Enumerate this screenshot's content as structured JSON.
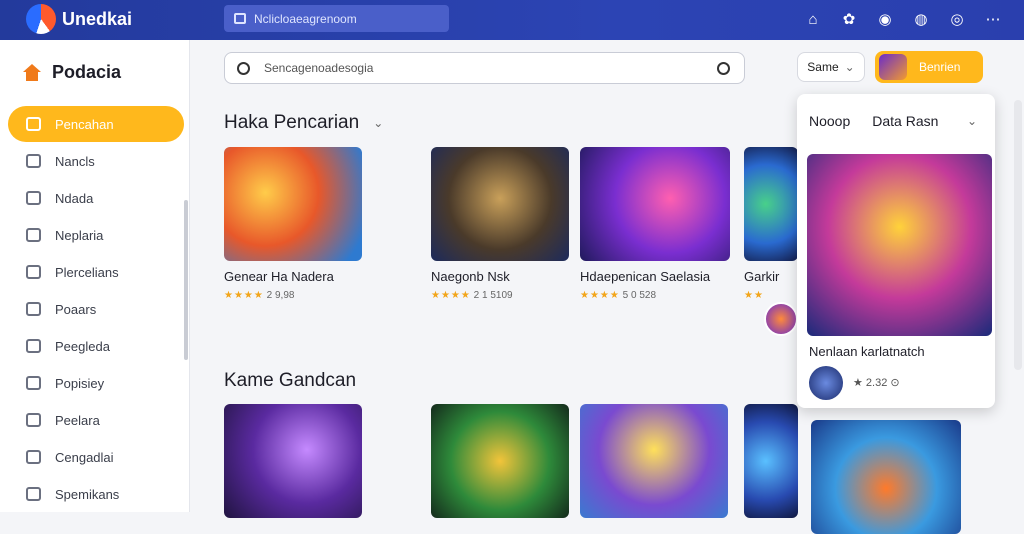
{
  "topbar": {
    "brand": "Unedkai",
    "url": "Nclicloaeagrenoom",
    "icons": [
      "home-icon",
      "extension-icon",
      "record-icon",
      "camera-icon",
      "profile-icon",
      "more-icon"
    ]
  },
  "sidebar": {
    "title": "Podacia",
    "items": [
      {
        "label": "Pencahan",
        "active": true
      },
      {
        "label": "Nancls"
      },
      {
        "label": "Ndada"
      },
      {
        "label": "Neplaria"
      },
      {
        "label": "Plercelians"
      },
      {
        "label": "Poaars"
      },
      {
        "label": "Peegleda"
      },
      {
        "label": "Popisiey"
      },
      {
        "label": "Peelara"
      },
      {
        "label": "Cengadlai"
      },
      {
        "label": "Spemikans"
      }
    ]
  },
  "search": {
    "placeholder": "Sencagenoadesogia"
  },
  "sort": {
    "label": "Same"
  },
  "profile": {
    "label": "Benrien"
  },
  "section1": {
    "title": "Haka Pencarian",
    "cards": [
      {
        "name": "Genear Ha Nadera",
        "stars": "★★★★",
        "rating": "2 9,98"
      },
      {
        "name": "Naegonb Nsk",
        "stars": "★★★★",
        "rating": "2 1 5109"
      },
      {
        "name": "Hdaepenican Saelasia",
        "stars": "★★★★",
        "rating": "5 0 528"
      },
      {
        "name": "Garkir",
        "stars": "★★",
        "rating": ""
      }
    ]
  },
  "section2": {
    "title": "Kame Gandcan"
  },
  "panel": {
    "tab1": "Nooop",
    "tab2": "Data Rasn",
    "name": "Nenlaan karlatnatch",
    "rating": "★ 2.32 ⊙"
  }
}
